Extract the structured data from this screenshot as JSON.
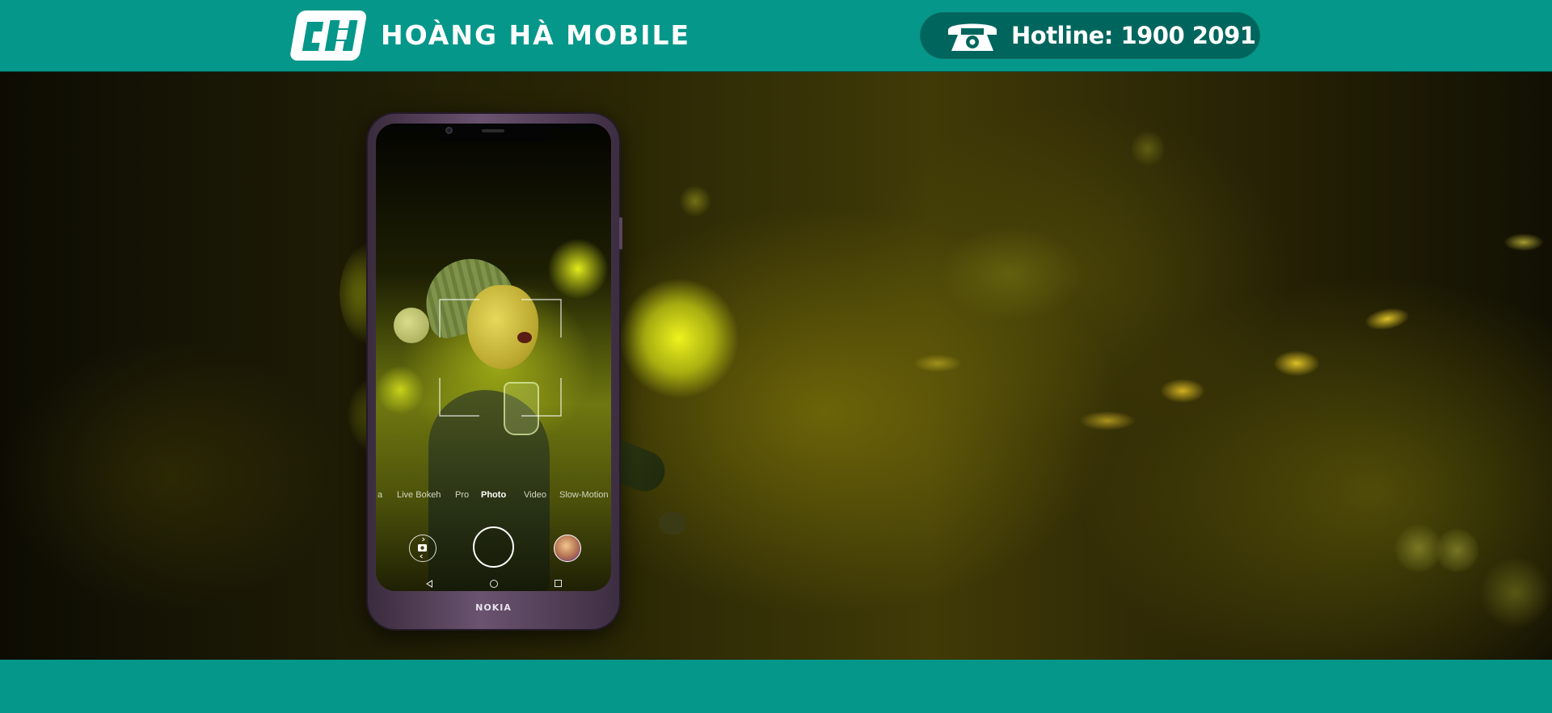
{
  "colors": {
    "brand": "#05978a",
    "hotline_pill": "#00665d",
    "text_light": "#ffffff"
  },
  "header": {
    "logo_icon": "hoang-ha-logo-icon",
    "brand_name": "HOÀNG HÀ MOBILE",
    "hotline_icon": "telephone-icon",
    "hotline_text": "Hotline: 1900 2091"
  },
  "banner": {
    "phone": {
      "brand": "NOKIA",
      "camera_modes": [
        "a",
        "Live Bokeh",
        "Pro",
        "Photo",
        "Video",
        "Slow-Motion"
      ],
      "active_mode": "Photo",
      "controls": [
        "camera-switch-icon",
        "shutter-button",
        "gallery-thumbnail"
      ],
      "navbar_icons": [
        "back-icon",
        "home-icon",
        "recents-icon"
      ]
    }
  },
  "footer": {}
}
